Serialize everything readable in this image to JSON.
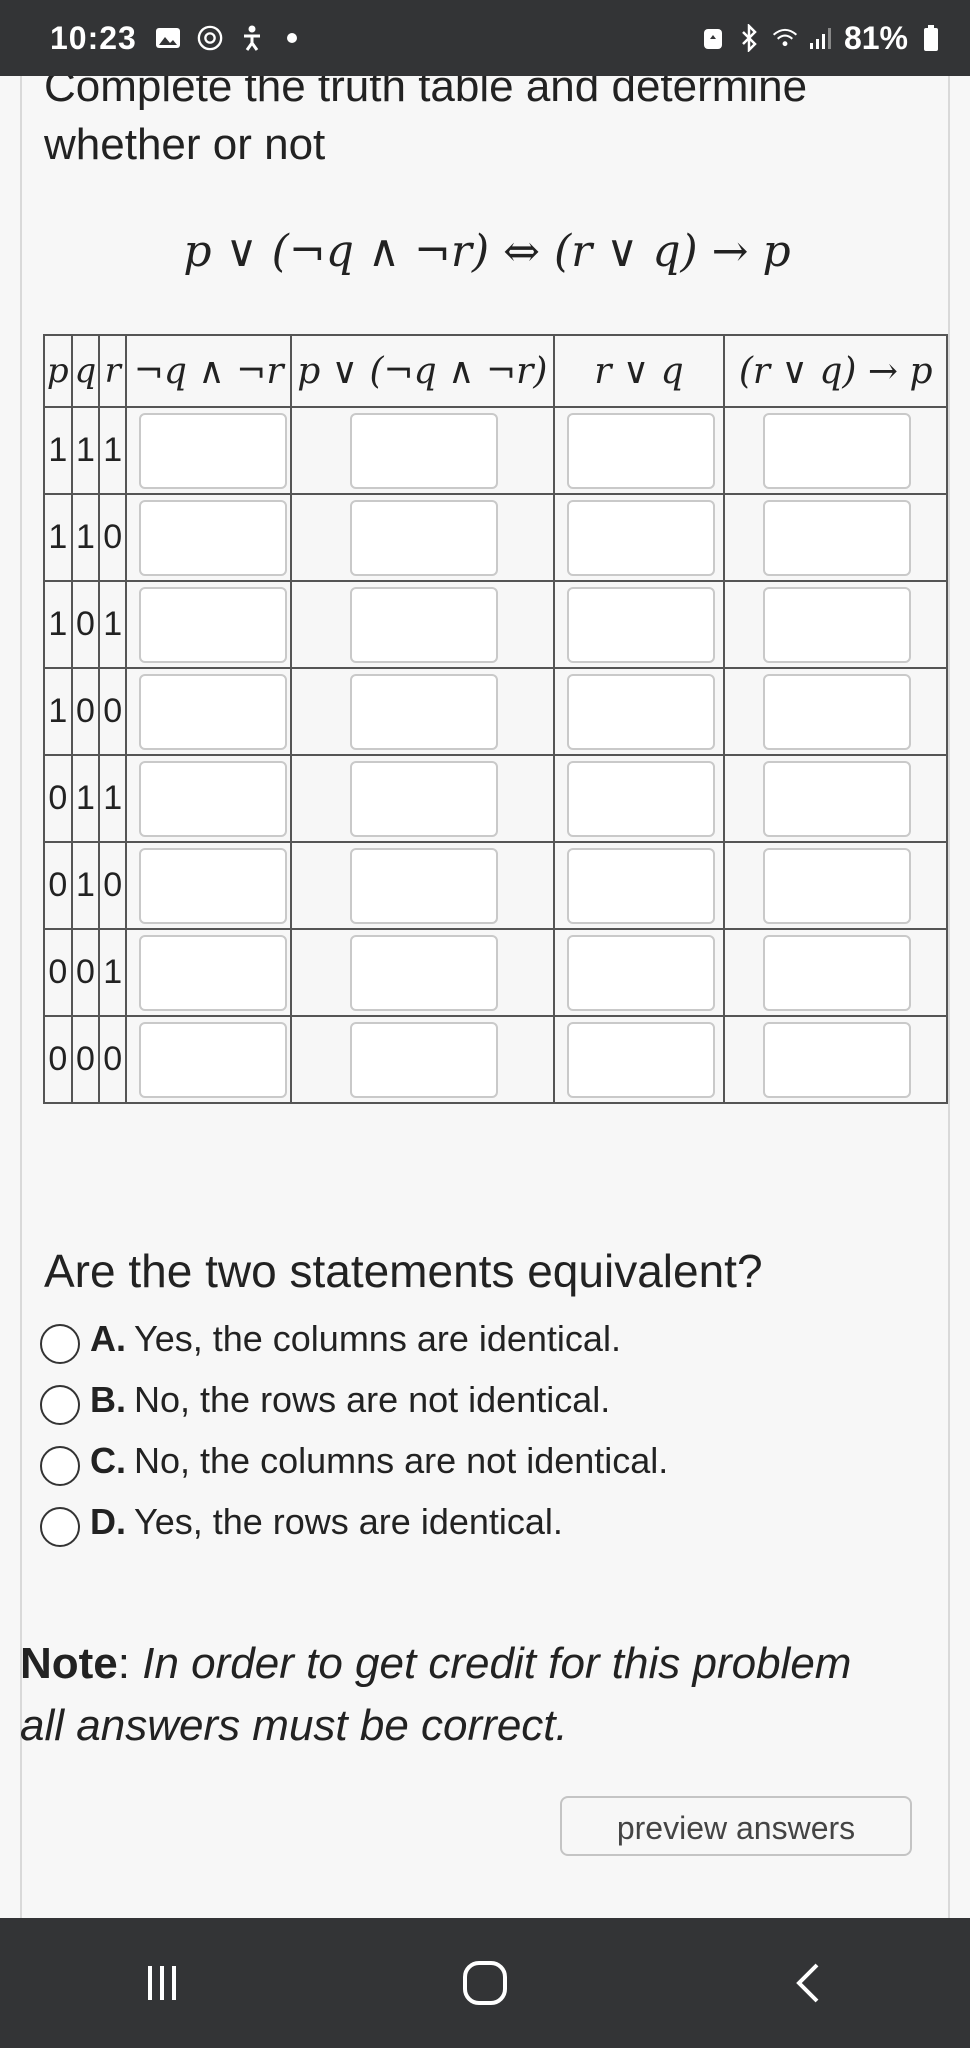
{
  "status_bar": {
    "time": "10:23",
    "battery": "81%",
    "icons_left": [
      "gallery-icon",
      "at-icon",
      "accessibility-icon",
      "notification-dot"
    ],
    "icons_right": [
      "battery-saver-icon",
      "bluetooth-icon",
      "wifi-icon",
      "signal-icon",
      "battery-icon"
    ]
  },
  "problem": {
    "intro": "Complete the truth table and determine whether or not",
    "formula": "p ∨ (¬q ∧ ¬r) ⇔ (r ∨ q) → p"
  },
  "table": {
    "headers": [
      "p",
      "q",
      "r",
      "¬q ∧ ¬r",
      "p ∨ (¬q ∧ ¬r)",
      "r ∨ q",
      "(r ∨ q) → p"
    ],
    "rows": [
      [
        "1",
        "1",
        "1"
      ],
      [
        "1",
        "1",
        "0"
      ],
      [
        "1",
        "0",
        "1"
      ],
      [
        "1",
        "0",
        "0"
      ],
      [
        "0",
        "1",
        "1"
      ],
      [
        "0",
        "1",
        "0"
      ],
      [
        "0",
        "0",
        "1"
      ],
      [
        "0",
        "0",
        "0"
      ]
    ]
  },
  "question": {
    "text": "Are the two statements equivalent?",
    "options": [
      {
        "letter": "A.",
        "text": "Yes, the columns are identical."
      },
      {
        "letter": "B.",
        "text": "No, the rows are not identical."
      },
      {
        "letter": "C.",
        "text": "No, the columns are not identical."
      },
      {
        "letter": "D.",
        "text": "Yes, the rows are identical."
      }
    ]
  },
  "note": {
    "label": "Note",
    "text": "In order to get credit for this problem all answers must be correct."
  },
  "buttons": {
    "preview": "preview answers"
  },
  "nav": [
    "recent-apps-icon",
    "home-icon",
    "back-icon"
  ],
  "colors": {
    "bars": "#333436",
    "background": "#f7f7f7",
    "input_border": "#c9c9c9"
  }
}
